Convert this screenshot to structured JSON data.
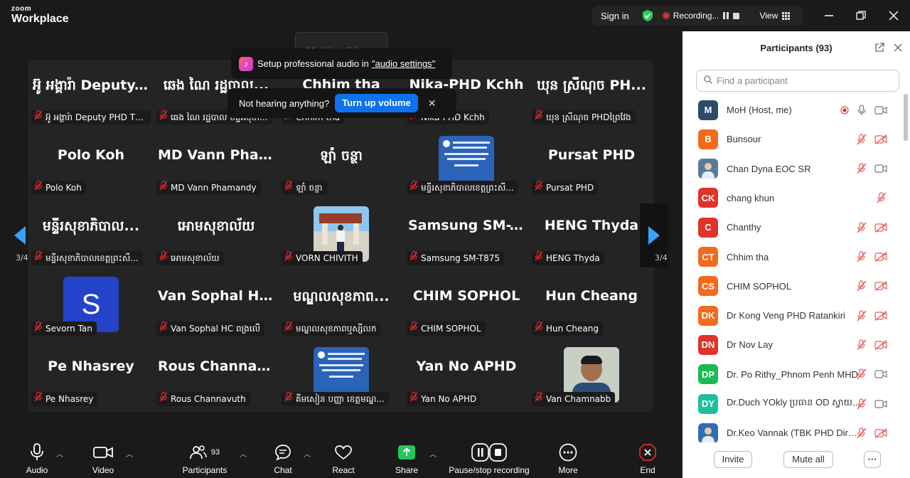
{
  "app": {
    "logo_top": "zoom",
    "logo_bottom": "Workplace"
  },
  "topbar": {
    "sign_in": "Sign in",
    "recording": "Recording...",
    "view": "View"
  },
  "overlay": {
    "talking": "MoH is talking...",
    "audio_prefix": "Setup professional audio in",
    "audio_link": "\"audio settings\"",
    "hearing_text": "Not hearing anything?",
    "turn_up": "Turn up volume",
    "close_glyph": "✕"
  },
  "pagination": {
    "left": "3/4",
    "right": "3/4"
  },
  "gallery": {
    "tiles": [
      {
        "name": "អ៊ូ អង្គារ៉ា Deputy...",
        "label": "អ៊ូ អង្គារ៉ា Deputy PHD TBK"
      },
      {
        "name": "ឆេង ណៃ រដ្ឋបាល...",
        "label": "ឆេង ណៃ រដ្ឋបាល មន្ទីរសុខា..."
      },
      {
        "name": "Chhim tha",
        "label": "Chhim tha"
      },
      {
        "name": "Nika-PHD Kchh",
        "label": "Nika-PHD Kchh"
      },
      {
        "name": "ឃុន ស្រីណុច PH...",
        "label": "ឃុន ស្រីណុច PHDព្រៃវែង"
      },
      {
        "name": "Polo Koh",
        "label": "Polo Koh"
      },
      {
        "name": "MD Vann Pham...",
        "label": "MD Vann Phamandy"
      },
      {
        "name": "ឡាំ ចន្ថា",
        "label": "ឡាំ ចន្ថា"
      },
      {
        "name": "",
        "label": "មន្ទីរសុខាភិបាលខេត្តព្រះសី..."
      },
      {
        "name": "Pursat PHD",
        "label": "Pursat PHD"
      },
      {
        "name": "មន្ទីរសុខាភិបាល...",
        "label": "មន្ទីរសុខាភិបាលខេត្តព្រះសី..."
      },
      {
        "name": "អោមសុខាល័យ",
        "label": "អោមសុខាល័យ"
      },
      {
        "name": "",
        "label": "VORN CHIVITH"
      },
      {
        "name": "Samsung SM-T...",
        "label": "Samsung SM-T875"
      },
      {
        "name": "HENG Thyda",
        "label": "HENG Thyda"
      },
      {
        "name": "",
        "label": "Sevorn Tan",
        "avatar": "S"
      },
      {
        "name": "Van Sophal HC...",
        "label": "Van Sophal HC ពង្រលើ"
      },
      {
        "name": "មណ្ឌលសុខភាព...",
        "label": "មណ្ឌលសុខភាពឬស្សីលក"
      },
      {
        "name": "CHIM SOPHOL",
        "label": "CHIM SOPHOL"
      },
      {
        "name": "Hun Cheang",
        "label": "Hun Cheang"
      },
      {
        "name": "Pe Nhasrey",
        "label": "Pe Nhasrey"
      },
      {
        "name": "Rous Channavuth",
        "label": "Rous Channavuth"
      },
      {
        "name": "",
        "label": "គីមសៀន បញ្ញា ខេត្តមណ្ឌ..."
      },
      {
        "name": "Yan No APHD",
        "label": "Yan No APHD"
      },
      {
        "name": "",
        "label": "Van Chamnabb"
      }
    ]
  },
  "toolbar": {
    "audio": "Audio",
    "video": "Video",
    "participants": "Participants",
    "participants_count": "93",
    "chat": "Chat",
    "react": "React",
    "share": "Share",
    "pause_stop": "Pause/stop recording",
    "more": "More",
    "end": "End"
  },
  "panel": {
    "title": "Participants (93)",
    "search_placeholder": "Find a participant",
    "invite": "Invite",
    "mute_all": "Mute all",
    "more_glyph": "···",
    "participants": [
      {
        "initials": "M",
        "name": "MoH (Host, me)",
        "color": "#2d4a6b"
      },
      {
        "initials": "B",
        "name": "Bunsour",
        "color": "#f26a1b"
      },
      {
        "initials": "",
        "name": "Chan Dyna EOC SR",
        "color": "#5a7a9a"
      },
      {
        "initials": "CK",
        "name": "chang khun",
        "color": "#e0332b"
      },
      {
        "initials": "C",
        "name": "Chanthy",
        "color": "#e0332b"
      },
      {
        "initials": "CT",
        "name": "Chhim tha",
        "color": "#f26a1b"
      },
      {
        "initials": "CS",
        "name": "CHIM SOPHOL",
        "color": "#f26a1b"
      },
      {
        "initials": "DK",
        "name": "Dr Kong Veng PHD Ratankiri",
        "color": "#f26a1b"
      },
      {
        "initials": "DN",
        "name": "Dr Nov Lay",
        "color": "#e0332b"
      },
      {
        "initials": "DP",
        "name": "Dr. Po Rithy_Phnom Penh MHD",
        "color": "#1db954"
      },
      {
        "initials": "DY",
        "name": "Dr.Duch YOkly ប្រធាន OD ស្វាយ...",
        "color": "#1dbfa0"
      },
      {
        "initials": "",
        "name": "Dr.Keo Vannak (TBK PHD Direct...",
        "color": "#2f6db5"
      }
    ]
  }
}
